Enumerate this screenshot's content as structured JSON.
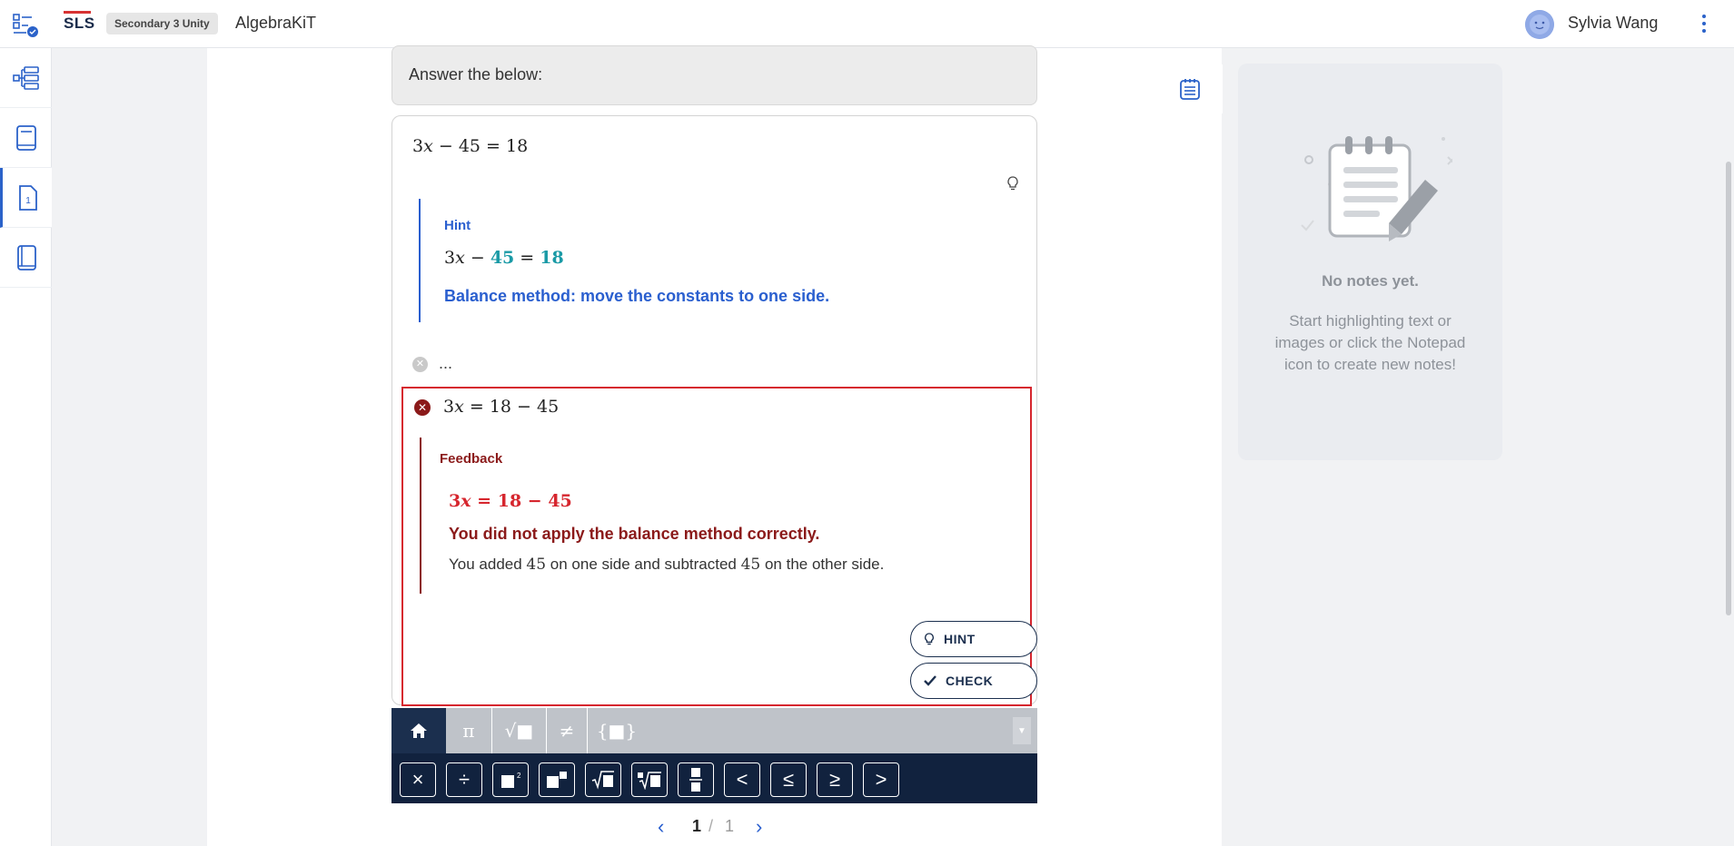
{
  "header": {
    "logo": "SLS",
    "class_badge": "Secondary 3 Unity",
    "app_title": "AlgebraKiT",
    "user_name": "Sylvia Wang"
  },
  "question": {
    "prompt": "Answer the below:"
  },
  "steps": {
    "given_equation": {
      "a": "3",
      "x": "x",
      "op": " − ",
      "b": "45",
      "eq": " = ",
      "c": "18"
    },
    "hint": {
      "label": "Hint",
      "eq_a": "3",
      "eq_x": "x",
      "eq_op": " − ",
      "eq_b": "45",
      "eq_eq": " = ",
      "eq_c": "18",
      "message": "Balance method: move the constants to one side."
    },
    "previous_step": "...",
    "current": {
      "eq_a": "3",
      "eq_x": "x",
      "eq_eq": " = ",
      "eq_b": "18",
      "eq_op": " − ",
      "eq_c": "45"
    },
    "feedback": {
      "label": "Feedback",
      "eq_a": "3",
      "eq_x": "x",
      "eq_eq": " = ",
      "eq_b": "18",
      "eq_op": " − ",
      "eq_c": "45",
      "message": "You did not apply the balance method correctly.",
      "detail_1": "You added ",
      "detail_num_1": "45",
      "detail_2": " on one side and subtracted ",
      "detail_num_2": "45",
      "detail_3": " on the other side."
    },
    "buttons": {
      "hint": "HINT",
      "check": "CHECK"
    }
  },
  "keyboard": {
    "tabs": [
      "home-icon",
      "π",
      "√■",
      "≠",
      "{■}"
    ],
    "keys": [
      "×",
      "÷",
      "■²",
      "■■",
      "√■",
      "∜■",
      "■/■",
      "<",
      "≤",
      "≥",
      ">"
    ]
  },
  "pagination": {
    "current": "1",
    "separator": "/",
    "total": "1"
  },
  "notes": {
    "title": "No notes yet.",
    "description": "Start highlighting text or images or click the Notepad icon to create new notes!"
  },
  "colors": {
    "primary_blue": "#2a5fcf",
    "navy": "#1b2f4e",
    "error_red": "#d6262e",
    "error_dark": "#8b1a1a",
    "hint_teal": "#1a9aa6"
  }
}
